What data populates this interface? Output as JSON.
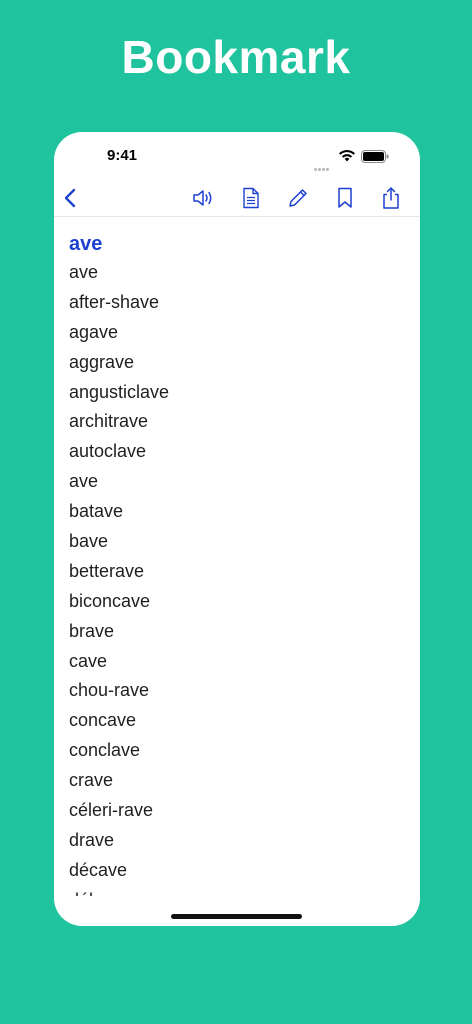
{
  "banner": {
    "title": "Bookmark"
  },
  "status_bar": {
    "time": "9:41"
  },
  "toolbar": {
    "icons": [
      "back-chevron-icon",
      "speaker-icon",
      "document-icon",
      "pencil-icon",
      "bookmark-icon",
      "share-icon"
    ],
    "accent_color": "#1c40d0"
  },
  "entry": {
    "headword": "ave",
    "words": [
      "ave",
      "after-shave",
      "agave",
      "aggrave",
      "angusticlave",
      "architrave",
      "autoclave",
      "ave",
      "batave",
      "bave",
      "betterave",
      "biconcave",
      "brave",
      "cave",
      "chou-rave",
      "concave",
      "conclave",
      "crave",
      "céleri-rave",
      "drave",
      "décave",
      "délave"
    ]
  },
  "colors": {
    "background": "#1fc39e",
    "text": "#1f1f1f"
  }
}
